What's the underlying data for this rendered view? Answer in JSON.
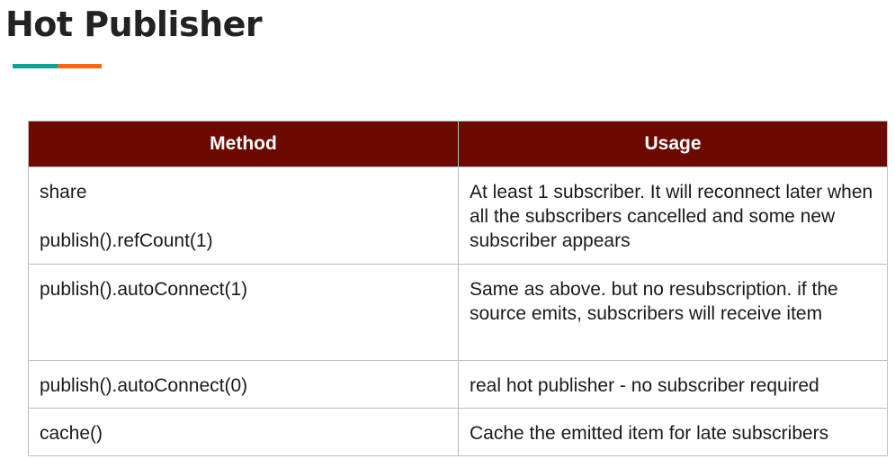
{
  "page": {
    "title": "Hot Publisher"
  },
  "colors": {
    "accent_left": "#16a090",
    "accent_right": "#ee6a1e",
    "header_bg": "#6b0a02",
    "header_text": "#ffffff",
    "border": "#bdbdbd"
  },
  "table": {
    "headers": [
      "Method",
      "Usage"
    ],
    "rows": [
      {
        "method_lines": [
          "share",
          "publish().refCount(1)"
        ],
        "usage": "At least 1 subscriber. It will reconnect later when all the subscribers cancelled and some new subscriber appears"
      },
      {
        "method_lines": [
          "publish().autoConnect(1)"
        ],
        "usage": "Same as above. but no resubscription. if the source emits, subscribers will receive item"
      },
      {
        "method_lines": [
          "publish().autoConnect(0)"
        ],
        "usage": "real hot publisher - no subscriber required"
      },
      {
        "method_lines": [
          "cache()"
        ],
        "usage": "Cache the emitted item for late subscribers"
      }
    ]
  }
}
